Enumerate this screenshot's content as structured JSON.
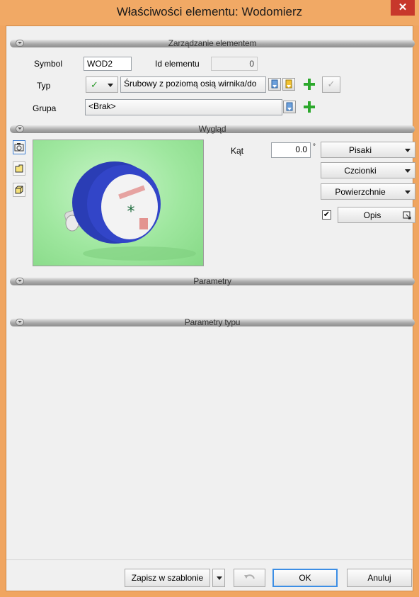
{
  "window": {
    "title": "Właściwości elementu: Wodomierz",
    "close_glyph": "✕"
  },
  "sections": {
    "management": "Zarządzanie elementem",
    "appearance": "Wygląd",
    "parameters": "Parametry",
    "type_parameters": "Parametry typu"
  },
  "management": {
    "symbol_label": "Symbol",
    "symbol_value": "WOD2",
    "id_label": "Id elementu",
    "id_value": "0",
    "type_label": "Typ",
    "type_check": "✓",
    "type_value": "Śrubowy z poziomą osią wirnika/do",
    "group_label": "Grupa",
    "group_value": "<Brak>"
  },
  "appearance": {
    "angle_label": "Kąt",
    "angle_value": "0.0",
    "angle_unit": "°",
    "pens": "Pisaki",
    "fonts": "Czcionki",
    "surfaces": "Powierzchnie",
    "description": "Opis",
    "description_checked": true
  },
  "footer": {
    "save_template": "Zapisz w szablonie",
    "ok": "OK",
    "cancel": "Anuluj"
  },
  "colors": {
    "title_bar": "#f1a965",
    "close": "#c7372b",
    "add_green": "#2ca82c",
    "preview_bg": "#a6e8a6"
  }
}
